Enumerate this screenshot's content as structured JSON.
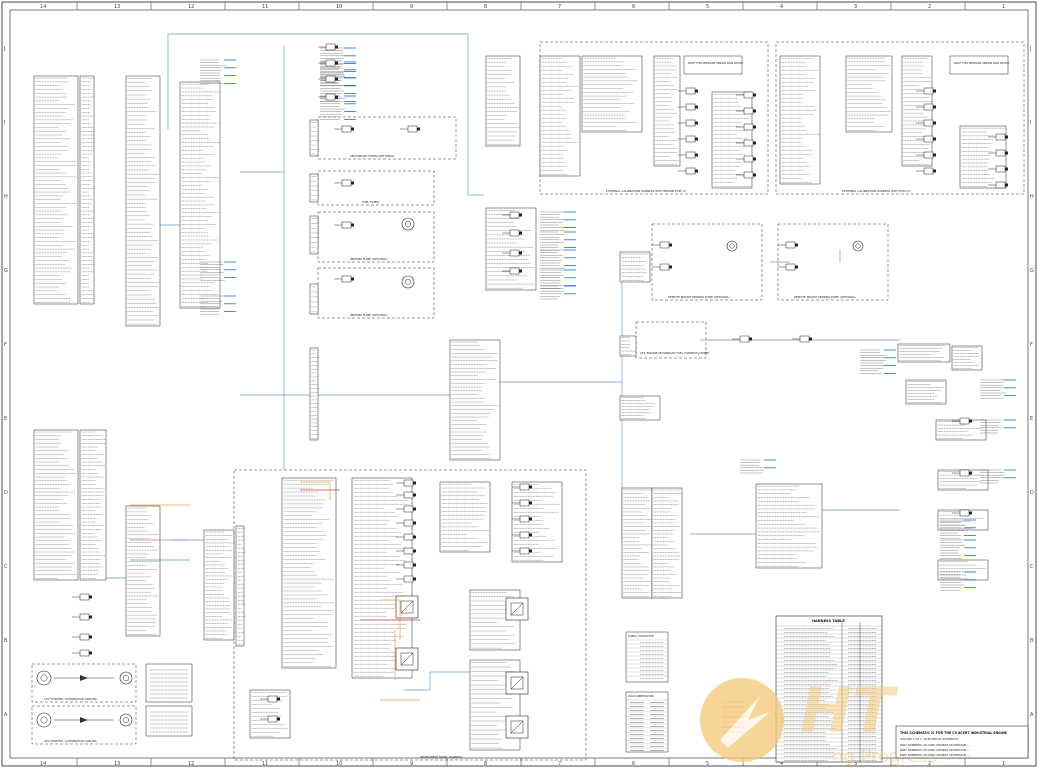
{
  "zones_top": [
    "14",
    "13",
    "12",
    "11",
    "10",
    "9",
    "8",
    "7",
    "6",
    "5",
    "4",
    "3",
    "2",
    "1"
  ],
  "zones_side": [
    "J",
    "I",
    "H",
    "G",
    "F",
    "E",
    "D",
    "C",
    "B",
    "A"
  ],
  "captions": {
    "secondary_filter": "SECONDARY FILTER (OPTIONAL)",
    "fuel_filter": "FUEL FILTER",
    "priming_pump_1": "PRIMING PUMP (OPTIONAL)",
    "priming_pump_2": "PRIMING PUMP (OPTIONAL)",
    "injector_harness_left": "EXTERNAL CALIBRATION HARNESS WITH ENGINE ECM (1)",
    "injector_harness_right": "EXTERNAL CALIBRATION HARNESS WITH ECM (2)",
    "remote_priming_left": "REMOTE MOUNT PRIMING PUMP (OPTIONAL)",
    "remote_priming_right": "REMOTE MOUNT PRIMING PUMP (OPTIONAL)",
    "fuel_jumper": "AFT. ENGINE SECONDARY FUEL HARNESS JUMPER",
    "instrument_panel": "INSTRUMENT PANEL HARNESS",
    "starter_1": "12V STARTER / ALTERNATOR CABLING",
    "starter_2": "24V STARTER / ALTERNATOR CABLING",
    "fuel_press_1": "RIGHT FUEL PRESSURE SENSOR MAIN SWITCH",
    "fuel_press_2": "RIGHT FUEL PRESSURE SENSOR MAIN SWITCH"
  },
  "tables": {
    "harness_title": "HARNESS TABLE",
    "symbols_title": "SYMBOL / DESCRIPTION",
    "color_title": "COLOR ABBREVIATIONS"
  },
  "title_block": {
    "line1": "THIS SCHEMATIC IS FOR THE C9 ACERT INDUSTRIAL ENGINE",
    "line2": "VOLUME 1 OF 2 - ELECTRICAL SCHEMATIC",
    "line3": "PART NUMBERS: 00-0000 CHANGE 00-VERSION --",
    "line4": "PART NUMBERS: 00-0000 CHANGE 00-VERSION --",
    "line5": "PART NUMBERS: 00-0000 CHANGE 00-VERSION --"
  },
  "watermark": {
    "logo": "HT",
    "text": "ng Progress"
  },
  "colors": {
    "wire_blue": "#8fb4d9",
    "link_blue": "#1a6fd0",
    "line": "#333333",
    "orange": "#e8a040",
    "red": "#d04030",
    "watermark": "#f5c878"
  }
}
